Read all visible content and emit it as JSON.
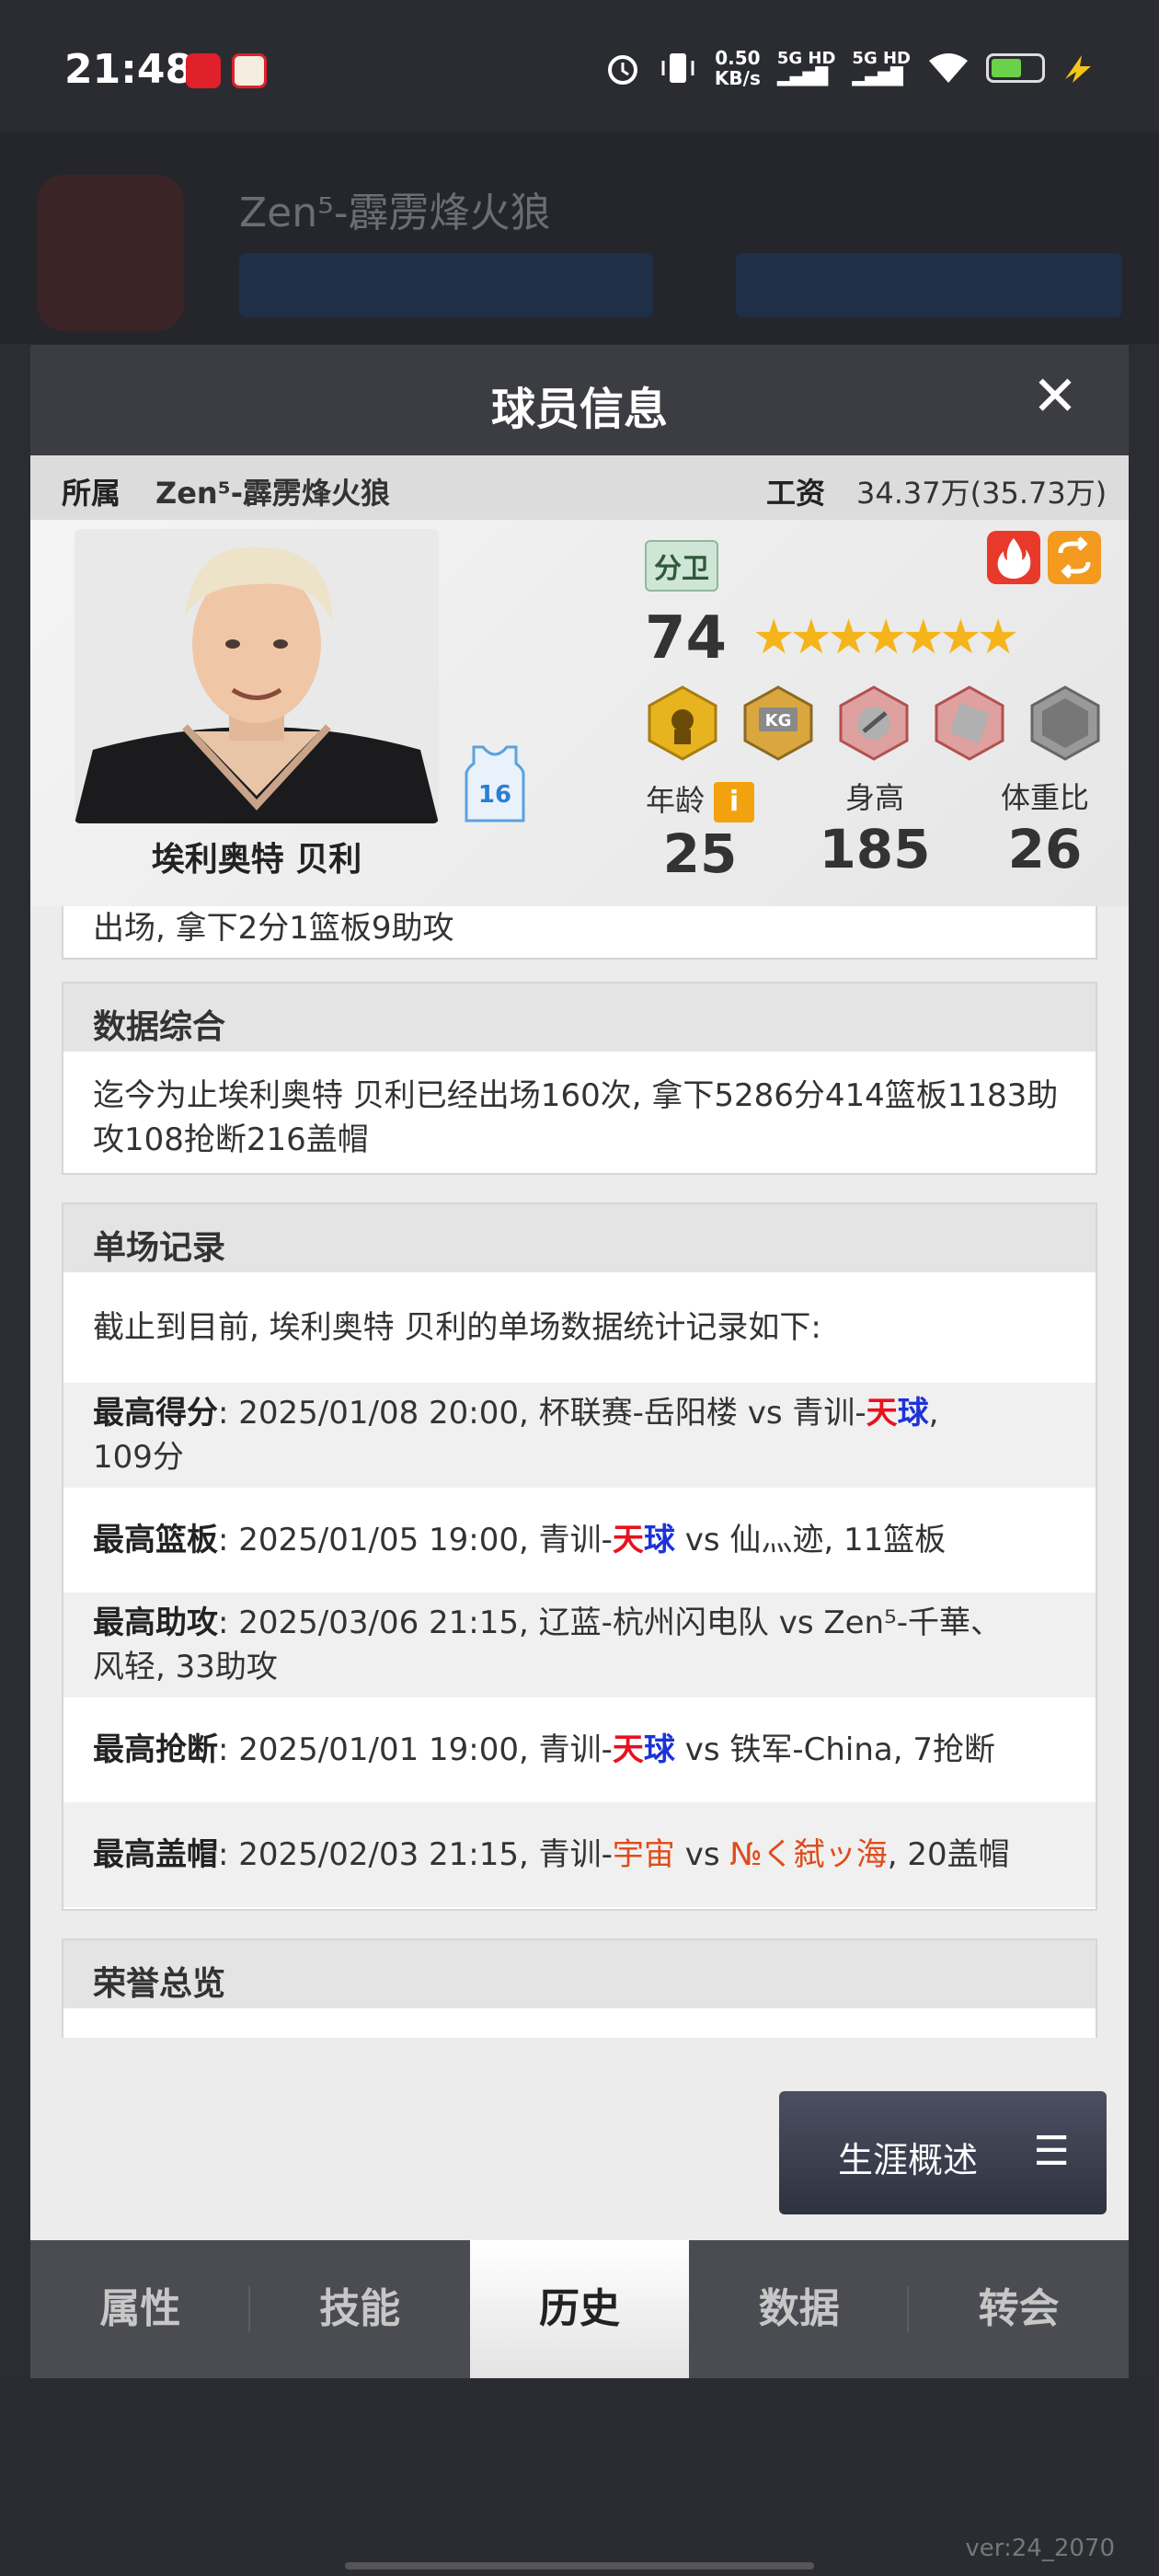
{
  "status_bar": {
    "time": "21:48",
    "speed_value": "0.50",
    "speed_unit": "KB/s",
    "net1": "5G HD",
    "net2": "5G HD"
  },
  "background": {
    "team_title": "Zen⁵-霹雳烽火狼",
    "version": "ver:24_2070"
  },
  "modal": {
    "title": "球员信息",
    "team_label": "所属",
    "team_value": "Zen⁵-霹雳烽火狼",
    "salary_label": "工资",
    "salary_value": "34.37万(35.73万)"
  },
  "player": {
    "name": "埃利奥特 贝利",
    "jersey_number": "16",
    "position": "分卫",
    "rating": "74",
    "stars": "★★★★★★★",
    "age_label": "年龄",
    "age_value": "25",
    "height_label": "身高",
    "height_value": "185",
    "bmi_label": "体重比",
    "bmi_value": "26",
    "info_icon": "i"
  },
  "sections": {
    "partial_text": "出场, 拿下2分1篮板9助攻",
    "summary_title": "数据综合",
    "summary_text": "迄今为止埃利奥特 贝利已经出场160次, 拿下5286分414篮板1183助攻108抢断216盖帽",
    "records_title": "单场记录",
    "records_intro": "截止到目前, 埃利奥特 贝利的单场数据统计记录如下:",
    "records": [
      {
        "label": "最高得分",
        "pre": ": 2025/01/08 20:00, 杯联赛-岳阳楼 vs 青训-",
        "hl1": "天",
        "hl2": "球",
        "post": ",",
        "line2": "109分"
      },
      {
        "label": "最高篮板",
        "pre": ": 2025/01/05 19:00, 青训-",
        "hl1": "天",
        "hl2": "球",
        "post": " vs 仙灬迹, 11篮板"
      },
      {
        "label": "最高助攻",
        "pre": ": 2025/03/06 21:15, 辽蓝-杭州闪电队 vs Zen⁵-千華、",
        "line2": "风轻, 33助攻"
      },
      {
        "label": "最高抢断",
        "pre": ": 2025/01/01 19:00, 青训-",
        "hl1": "天",
        "hl2": "球",
        "post": " vs 铁军-China, 7抢断"
      },
      {
        "label": "最高盖帽",
        "pre": ": 2025/02/03 21:15, 青训-",
        "team1": "宇宙",
        "mid": " vs ",
        "team2": "№く弑ッ海",
        "post": ", 20盖帽"
      }
    ],
    "honors_title": "荣誉总览"
  },
  "career_button": {
    "label": "生涯概述",
    "menu_icon": "☰"
  },
  "tabs": [
    "属性",
    "技能",
    "历史",
    "数据",
    "转会"
  ],
  "active_tab": "历史",
  "colors": {
    "highlight_red": "#e8111e",
    "highlight_blue": "#1c33d8",
    "team_orange": "#e04b1a"
  }
}
